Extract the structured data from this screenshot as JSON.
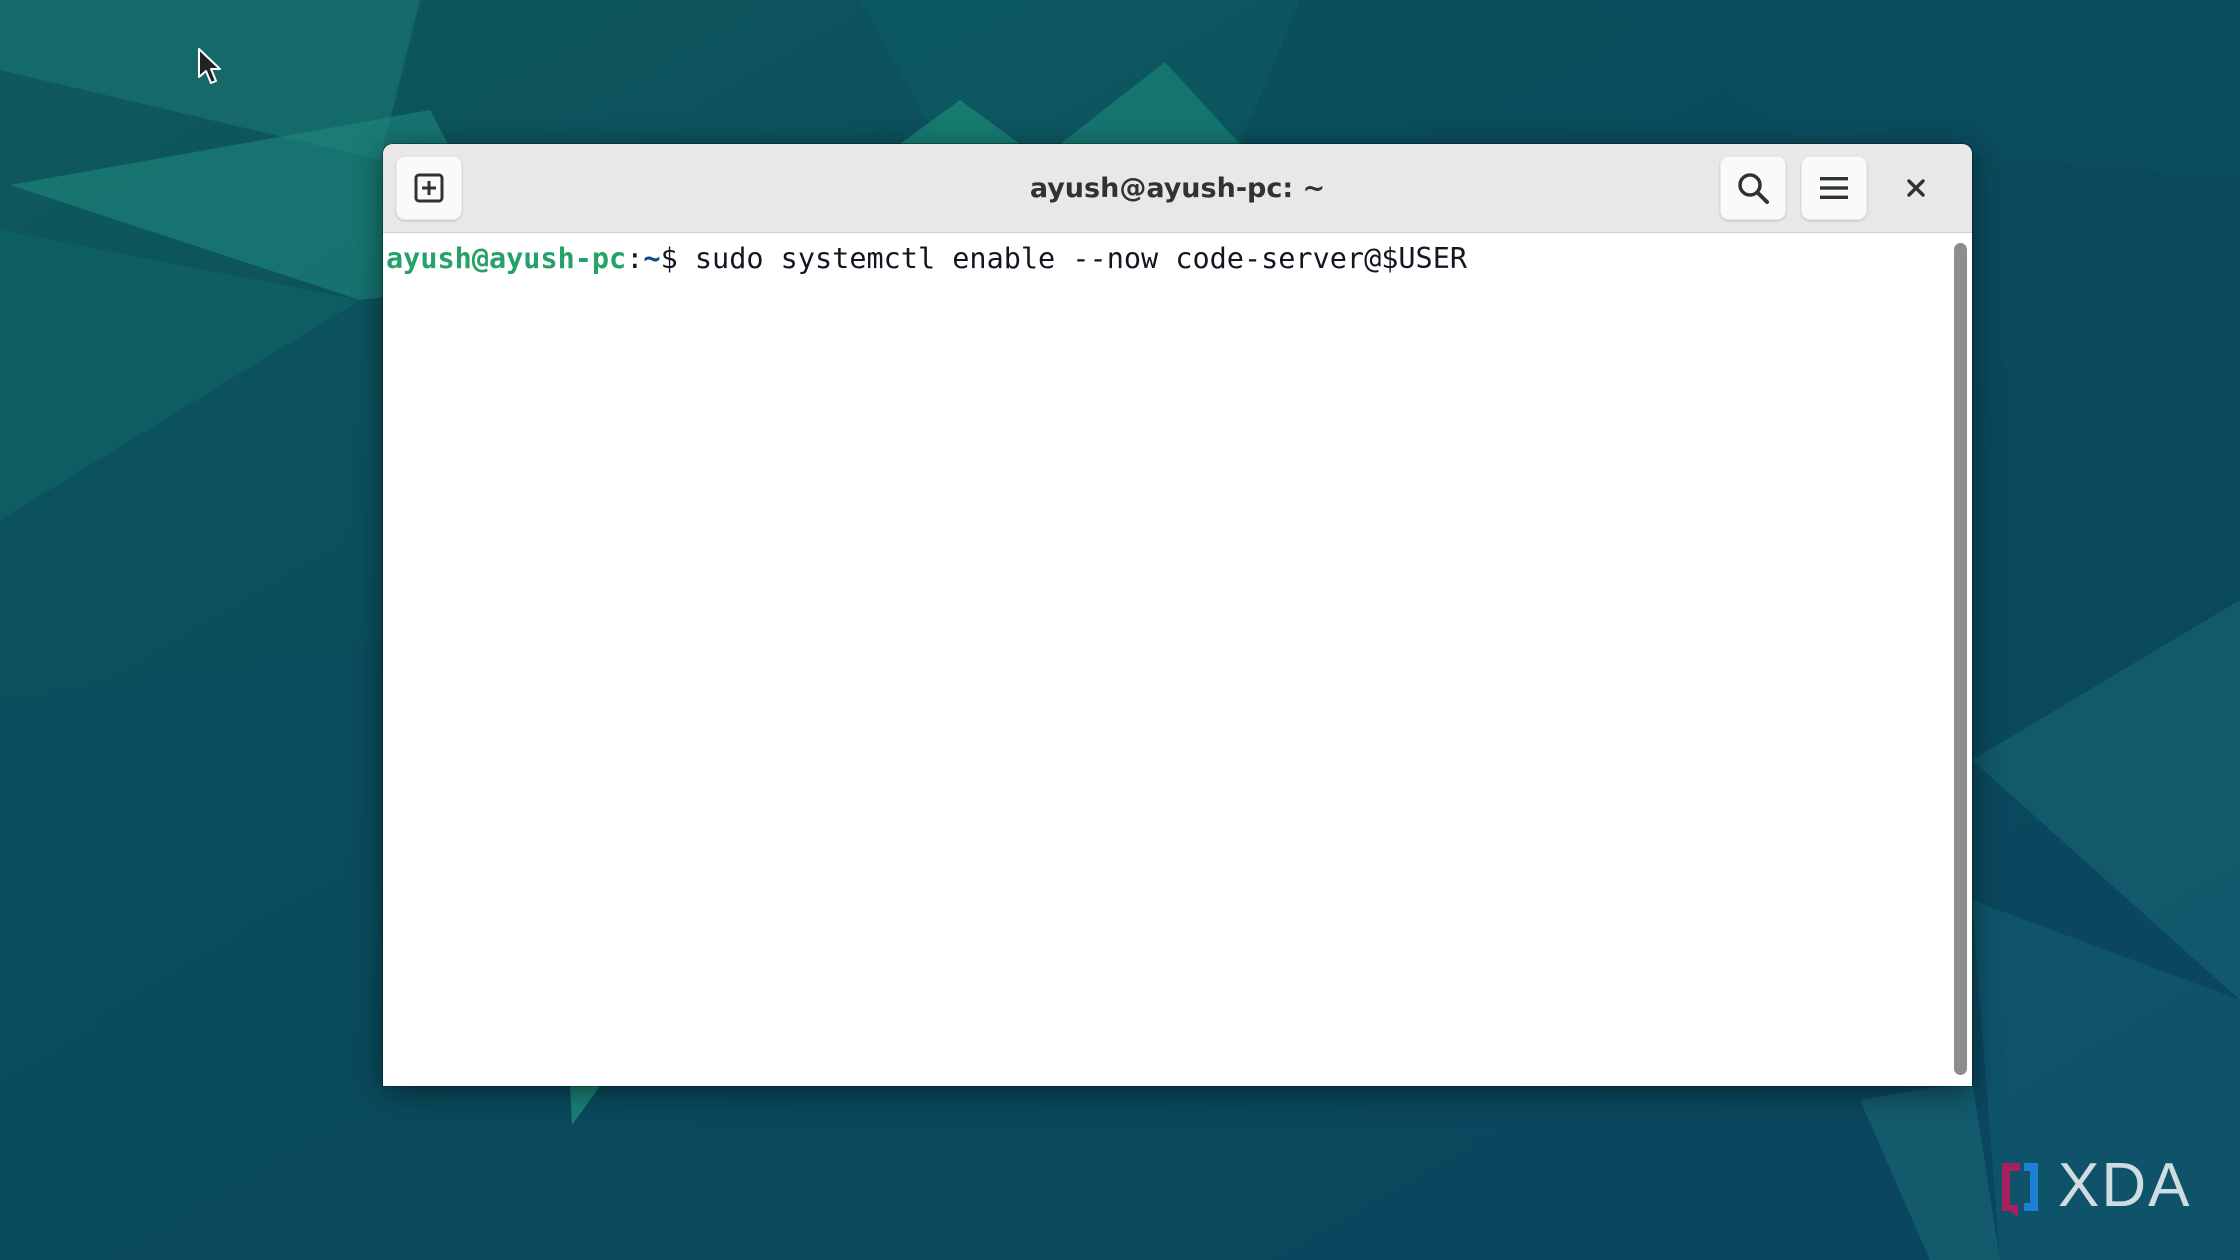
{
  "window": {
    "title": "ayush@ayush-pc: ~"
  },
  "terminal": {
    "prompt_user_host": "ayush@ayush-pc",
    "prompt_separator": ":",
    "prompt_path": "~",
    "prompt_symbol": "$ ",
    "command": "sudo systemctl enable --now code-server@$USER"
  },
  "icons": {
    "new_tab": "new-tab-icon",
    "search": "search-icon",
    "menu": "hamburger-menu-icon",
    "close": "close-icon",
    "cursor": "mouse-pointer-icon"
  },
  "watermark": {
    "text": "XDA"
  },
  "colors": {
    "prompt_user": "#26a269",
    "prompt_path": "#12488b",
    "desktop": "#0b4f5c"
  }
}
